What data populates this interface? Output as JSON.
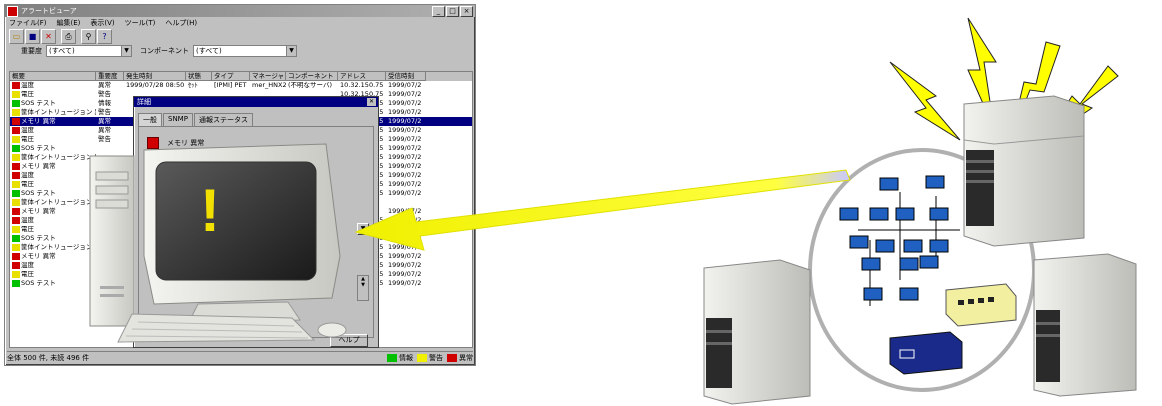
{
  "window": {
    "title": "アラートビューア",
    "buttons": [
      "_",
      "□",
      "×"
    ]
  },
  "menu": [
    "ファイル(F)",
    "編集(E)",
    "表示(V)",
    "ツール(T)",
    "ヘルプ(H)"
  ],
  "toolbar": {
    "icons": [
      "open-icon",
      "save-icon",
      "delete-icon",
      "print-icon",
      "find-icon",
      "help-icon"
    ]
  },
  "filters": {
    "severity_label": "重要度",
    "severity_value": "(すべて)",
    "component_label": "コンポーネント",
    "component_value": "(すべて)"
  },
  "columns": [
    "概要",
    "重要度",
    "発生時刻",
    "状態",
    "タイプ",
    "マネージャ",
    "コンポーネント",
    "アドレス",
    "受信時刻"
  ],
  "rows": [
    {
      "summary": "温度",
      "severity": "異常",
      "time": "1999/07/28 08:50",
      "state": "ｾｯﾄ",
      "type": "[IPMI] PET",
      "manager": "mer_HNX24",
      "component": "(不明なサーバ)",
      "address": "10.32.150.75",
      "recv": "1999/07/2",
      "color": "#d00000"
    },
    {
      "summary": "電圧",
      "severity": "警告",
      "address": "10.32.150.75",
      "recv": "1999/07/2",
      "color": "#e8e000"
    },
    {
      "summary": "SOS テスト",
      "severity": "情報",
      "address": "10.32.150.75",
      "recv": "1999/07/2",
      "color": "#00c000"
    },
    {
      "summary": "筐体イントリュージョン 異常",
      "severity": "警告",
      "address": "10.32.150.75",
      "recv": "1999/07/2",
      "color": "#e8e000"
    },
    {
      "summary": "メモリ 異常",
      "severity": "異常",
      "address": "10.32.150.75",
      "recv": "1999/07/2",
      "color": "#d00000",
      "selected": true
    },
    {
      "summary": "温度",
      "severity": "異常",
      "address": "10.32.150.75",
      "recv": "1999/07/2",
      "color": "#d00000"
    },
    {
      "summary": "電圧",
      "severity": "警告",
      "address": "10.32.150.75",
      "recv": "1999/07/2",
      "color": "#e8e000"
    },
    {
      "summary": "SOS テスト",
      "severity": "",
      "address": "10.32.150.75",
      "recv": "1999/07/2",
      "color": "#00c000"
    },
    {
      "summary": "筐体イントリュージョン 異常",
      "severity": "",
      "address": "10.32.150.75",
      "recv": "1999/07/2",
      "color": "#e8e000"
    },
    {
      "summary": "メモリ 異常",
      "severity": "",
      "address": "10.32.150.75",
      "recv": "1999/07/2",
      "color": "#d00000"
    },
    {
      "summary": "温度",
      "severity": "",
      "address": "10.32.150.75",
      "recv": "1999/07/2",
      "color": "#d00000"
    },
    {
      "summary": "電圧",
      "severity": "",
      "address": "10.32.150.75",
      "recv": "1999/07/2",
      "color": "#e8e000"
    },
    {
      "summary": "SOS テスト",
      "severity": "",
      "address": "10.32.150.75",
      "recv": "1999/07/2",
      "color": "#00c000"
    },
    {
      "summary": "筐体イントリュージョン 異常",
      "severity": "",
      "address": "",
      "recv": "",
      "color": "#e8e000"
    },
    {
      "summary": "メモリ 異常",
      "severity": "",
      "address": "",
      "recv": "1999/07/2",
      "color": "#d00000"
    },
    {
      "summary": "温度",
      "severity": "",
      "address": "10.32.150.75",
      "recv": "1999/07/2",
      "color": "#d00000"
    },
    {
      "summary": "電圧",
      "severity": "",
      "address": "10.32.150.75",
      "recv": "1999/07/2",
      "color": "#e8e000"
    },
    {
      "summary": "SOS テスト",
      "severity": "",
      "address": "10.32.150.75",
      "recv": "1999/07/2",
      "color": "#00c000"
    },
    {
      "summary": "筐体イントリュージョン 異常",
      "severity": "",
      "address": "10.32.150.75",
      "recv": "1999/07/2",
      "color": "#e8e000"
    },
    {
      "summary": "メモリ 異常",
      "severity": "",
      "address": "10.32.150.75",
      "recv": "1999/07/2",
      "color": "#d00000"
    },
    {
      "summary": "温度",
      "severity": "",
      "address": "10.32.150.75",
      "recv": "1999/07/2",
      "color": "#d00000"
    },
    {
      "summary": "電圧",
      "severity": "",
      "address": "10.32.150.75",
      "recv": "1999/07/2",
      "color": "#e8e000"
    },
    {
      "summary": "SOS テスト",
      "severity": "",
      "address": "10.32.150.75",
      "recv": "1999/07/2",
      "color": "#00c000"
    }
  ],
  "dialog": {
    "title": "詳細",
    "tabs": [
      "一般",
      "SNMP",
      "通報ステータス"
    ],
    "item": "メモリ 異常",
    "help_button": "ヘルプ"
  },
  "status": {
    "text": "全体 500 件, 未読 496 件",
    "legend": [
      {
        "label": "情報",
        "color": "#00c000"
      },
      {
        "label": "警告",
        "color": "#f0f000"
      },
      {
        "label": "異常",
        "color": "#d00000"
      }
    ]
  },
  "monitor": {
    "mark": "!"
  }
}
